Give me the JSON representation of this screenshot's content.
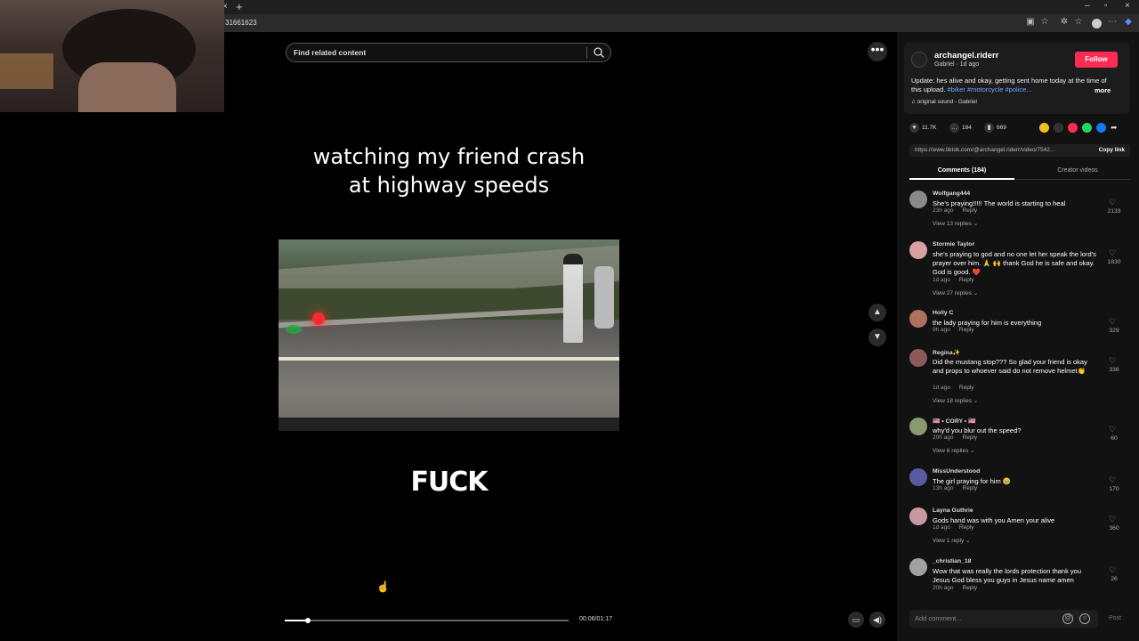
{
  "browser": {
    "url_fragment": "31661623",
    "tab_close": "×",
    "new_tab": "+",
    "win_min": "–",
    "win_max": "▫",
    "win_close": "×"
  },
  "video": {
    "search_placeholder": "Find related content",
    "caption_top_line1": "watching my friend crash",
    "caption_top_line2": "at highway speeds",
    "caption_bottom": "FUCK",
    "timecode": "00:06/01:17",
    "progress": 0.08
  },
  "controls": {
    "more": "•••",
    "up": "▲",
    "down": "▼"
  },
  "post": {
    "username": "archangel.riderr",
    "sub": "Gabriel · 1d ago",
    "follow_label": "Follow",
    "description": "Update: hes alive and okay, getting sent home today at the time of this upload. ",
    "tags": "#biker #motorcycle #police...",
    "more_label": "more",
    "music": "♫  original sound - Gabriel",
    "likes": "11.7K",
    "comments_count": "184",
    "saves": "669",
    "link": "https://www.tiktok.com/@archangel.riderr/video/7542...",
    "copy_label": "Copy link"
  },
  "tabs": {
    "comments": "Comments (184)",
    "creator": "Creator videos"
  },
  "comments": [
    {
      "name": "Wolfgang444",
      "text": "She's praying!!!!! The world is starting to heal",
      "time": "23h ago",
      "reply": "Reply",
      "replies": "View 13 replies ⌄",
      "likes": "2133",
      "color": "#8a8a8a"
    },
    {
      "name": "Stormie Taylor",
      "text": "she's praying to god and no one let her speak the lord's prayer over him. 🙏 🙌 thank God he is safe and okay. God is good. ❤️",
      "time": "1d ago",
      "reply": "Reply",
      "replies": "View 27 replies ⌄",
      "likes": "1830",
      "color": "#d8a0a0"
    },
    {
      "name": "Holly C",
      "text": "the lady praying for him is everything",
      "time": "9h ago",
      "reply": "Reply",
      "replies": "",
      "likes": "329",
      "color": "#b07060"
    },
    {
      "name": "Regina✨",
      "text": "Did the mustang stop??? So glad your friend is okay and props to whoever said do not remove helmet👏",
      "time": "1d ago",
      "reply": "Reply",
      "replies": "View 18 replies ⌄",
      "likes": "336",
      "color": "#8a5a5a"
    },
    {
      "name": "🇺🇸 • CORY • 🇺🇸",
      "text": "why'd you blur out the speed?",
      "time": "20h ago",
      "reply": "Reply",
      "replies": "View 6 replies ⌄",
      "likes": "60",
      "color": "#8a9a70"
    },
    {
      "name": "MissUnderstood",
      "text": "The girl praying for him 🥹",
      "time": "13h ago",
      "reply": "Reply",
      "replies": "",
      "likes": "170",
      "color": "#5a5aa0"
    },
    {
      "name": "Layna Guthrie",
      "text": "Gods hand was with you Amen your alive",
      "time": "1d ago",
      "reply": "Reply",
      "replies": "View 1 reply ⌄",
      "likes": "360",
      "color": "#c89aa0"
    },
    {
      "name": "_christian_18",
      "text": "Wow that was really the lords protection thank you Jesus God bless you guys in Jesus name amen",
      "time": "20h ago",
      "reply": "Reply",
      "replies": "",
      "likes": "26",
      "color": "#a0a0a0"
    }
  ],
  "input": {
    "placeholder": "Add comment...",
    "at": "@",
    "emoji": "☺",
    "post_label": "Post"
  }
}
